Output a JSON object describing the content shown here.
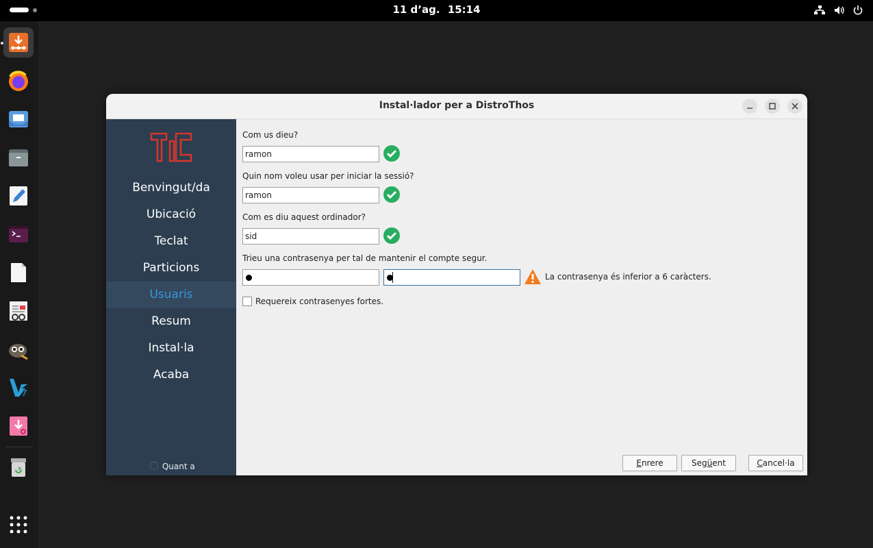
{
  "topbar": {
    "date": "11 d’ag.",
    "time": "15:14",
    "tray_icons": [
      "network-icon",
      "volume-icon",
      "power-icon"
    ]
  },
  "dock": {
    "apps": [
      "installer-icon",
      "firefox-icon",
      "mail-icon",
      "files-icon",
      "text-editor-icon",
      "terminal-icon",
      "document-icon",
      "document-viewer-icon",
      "gimp-icon",
      "vscodium-icon",
      "package-installer-icon",
      "trash-icon"
    ],
    "show_apps": "app-grid-icon"
  },
  "window": {
    "title": "Instal·lador per a DistroThos",
    "controls": [
      "minimize-icon",
      "maximize-icon",
      "close-icon"
    ]
  },
  "sidebar": {
    "items": [
      {
        "label": "Benvingut/da"
      },
      {
        "label": "Ubicació"
      },
      {
        "label": "Teclat"
      },
      {
        "label": "Particions"
      },
      {
        "label": "Usuaris"
      },
      {
        "label": "Resum"
      },
      {
        "label": "Instal·la"
      },
      {
        "label": "Acaba"
      }
    ],
    "active": "Usuaris",
    "about": "Quant a"
  },
  "form": {
    "name_label": "Com us dieu?",
    "name_value": "ramon",
    "login_label": "Quin nom voleu usar per iniciar la sessió?",
    "login_value": "ramon",
    "host_label": "Com es diu aquest ordinador?",
    "host_value": "sid",
    "password_label": "Trieu una contrasenya per tal de mantenir el compte segur.",
    "password_warning": "La contrasenya és inferior a 6 caràcters.",
    "strong_password_label": "Requereix contrasenyes fortes.",
    "strong_password_checked": false
  },
  "buttons": {
    "back_prefix": "E",
    "back_rest": "nrere",
    "next_prefix": "Seg",
    "next_mnemonic": "ü",
    "next_rest": "ent",
    "cancel_prefix": "",
    "cancel_mnemonic": "C",
    "cancel_rest": "ancel·la"
  },
  "colors": {
    "sidebar_bg": "#2c3e50",
    "sidebar_active_bg": "#34495e",
    "sidebar_active_text": "#3598db",
    "ok_green": "#27ae60",
    "warning_orange": "#f47a1f",
    "logo_red": "#d6342b"
  }
}
